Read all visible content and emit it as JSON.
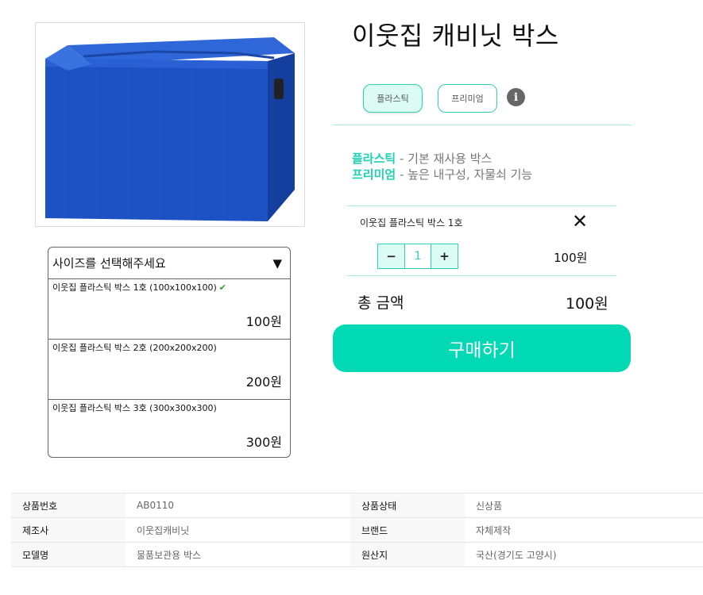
{
  "product": {
    "title": "이웃집 캐비닛 박스"
  },
  "types": {
    "plastic_label": "플라스틱",
    "premium_label": "프리미엄",
    "selected": "플라스틱"
  },
  "descriptions": [
    {
      "keyword": "플라스틱",
      "text": " - 기본 재사용 박스"
    },
    {
      "keyword": "프리미엄",
      "text": " - 높은 내구성, 자물쇠 기능"
    }
  ],
  "selected_item": {
    "name": "이웃집 플라스틱 박스 1호",
    "remove_symbol": "✕",
    "quantity": "1",
    "minus": "−",
    "plus": "+",
    "price": "100원"
  },
  "total": {
    "label": "총 금액",
    "value": "100원"
  },
  "buy_button": "구매하기",
  "size_select": {
    "placeholder": "사이즈를 선택해주세요",
    "caret": "▼",
    "options": [
      {
        "name": "이웃집 플라스틱 박스 1호 (100x100x100)",
        "price": "100원",
        "checked": true,
        "check": "✔"
      },
      {
        "name": "이웃집 플라스틱 박스 2호 (200x200x200)",
        "price": "200원",
        "checked": false
      },
      {
        "name": "이웃집 플라스틱 박스 3호 (300x300x300)",
        "price": "300원",
        "checked": false
      }
    ]
  },
  "info_table": {
    "rows": [
      {
        "k1": "상품번호",
        "v1": "AB0110",
        "k2": "상품상태",
        "v2": "신상품"
      },
      {
        "k1": "제조사",
        "v1": "이웃집캐비닛",
        "k2": "브랜드",
        "v2": "자체제작"
      },
      {
        "k1": "모델명",
        "v1": "물품보관용 박스",
        "k2": "원산지",
        "v2": "국산(경기도 고양시)"
      }
    ]
  },
  "colors": {
    "accent": "#00d9b4",
    "accent_light": "#dcfbf3",
    "box_blue": "#1a52c8"
  }
}
